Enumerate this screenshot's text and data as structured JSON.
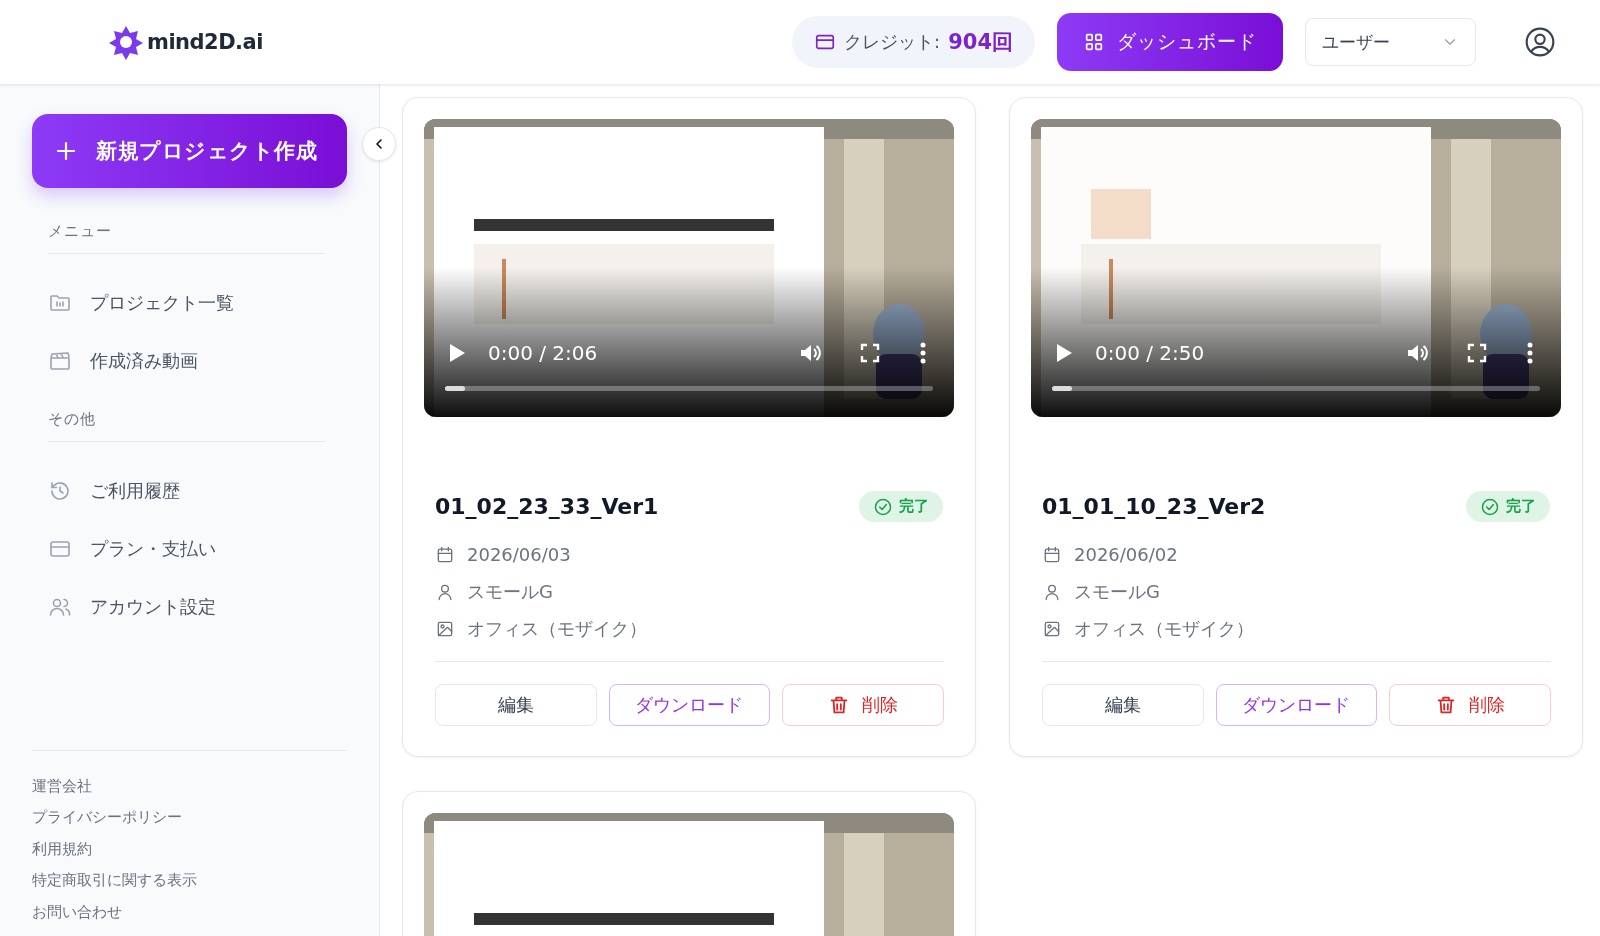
{
  "header": {
    "logo": "mind2D.ai",
    "credits": {
      "label": "クレジット:",
      "value": "904回"
    },
    "dashboard_button": "ダッシュボード",
    "user_select": {
      "value": "ユーザー"
    }
  },
  "sidebar": {
    "new_project_button": "新規プロジェクト作成",
    "sections": [
      {
        "title": "メニュー",
        "items": [
          {
            "label": "プロジェクト一覧"
          },
          {
            "label": "作成済み動画"
          }
        ]
      },
      {
        "title": "その他",
        "items": [
          {
            "label": "ご利用履歴"
          },
          {
            "label": "プラン・支払い"
          },
          {
            "label": "アカウント設定"
          }
        ]
      }
    ],
    "footer_links": [
      "運営会社",
      "プライバシーポリシー",
      "利用規約",
      "特定商取引に関する表示",
      "お問い合わせ"
    ]
  },
  "videos": [
    {
      "kind": "full",
      "player": {
        "time": "0:00 / 2:06",
        "level": 0.04
      },
      "title": "01_02_23_33_Ver1",
      "status": {
        "label": "完了",
        "color": "#16a34a"
      },
      "date": "2026/06/03",
      "character": "スモールG",
      "background": "オフィス（モザイク）",
      "buttons": {
        "edit": "編集",
        "download": "ダウンロード",
        "delete": "削除"
      }
    },
    {
      "kind": "full",
      "player": {
        "time": "0:00 / 2:50",
        "level": 0.04
      },
      "title": "01_01_10_23_Ver2",
      "status": {
        "label": "完了",
        "color": "#16a34a"
      },
      "date": "2026/06/02",
      "character": "スモールG",
      "background": "オフィス（モザイク）",
      "buttons": {
        "edit": "編集",
        "download": "ダウンロード",
        "delete": "削除"
      }
    },
    {
      "kind": "partial"
    }
  ]
}
